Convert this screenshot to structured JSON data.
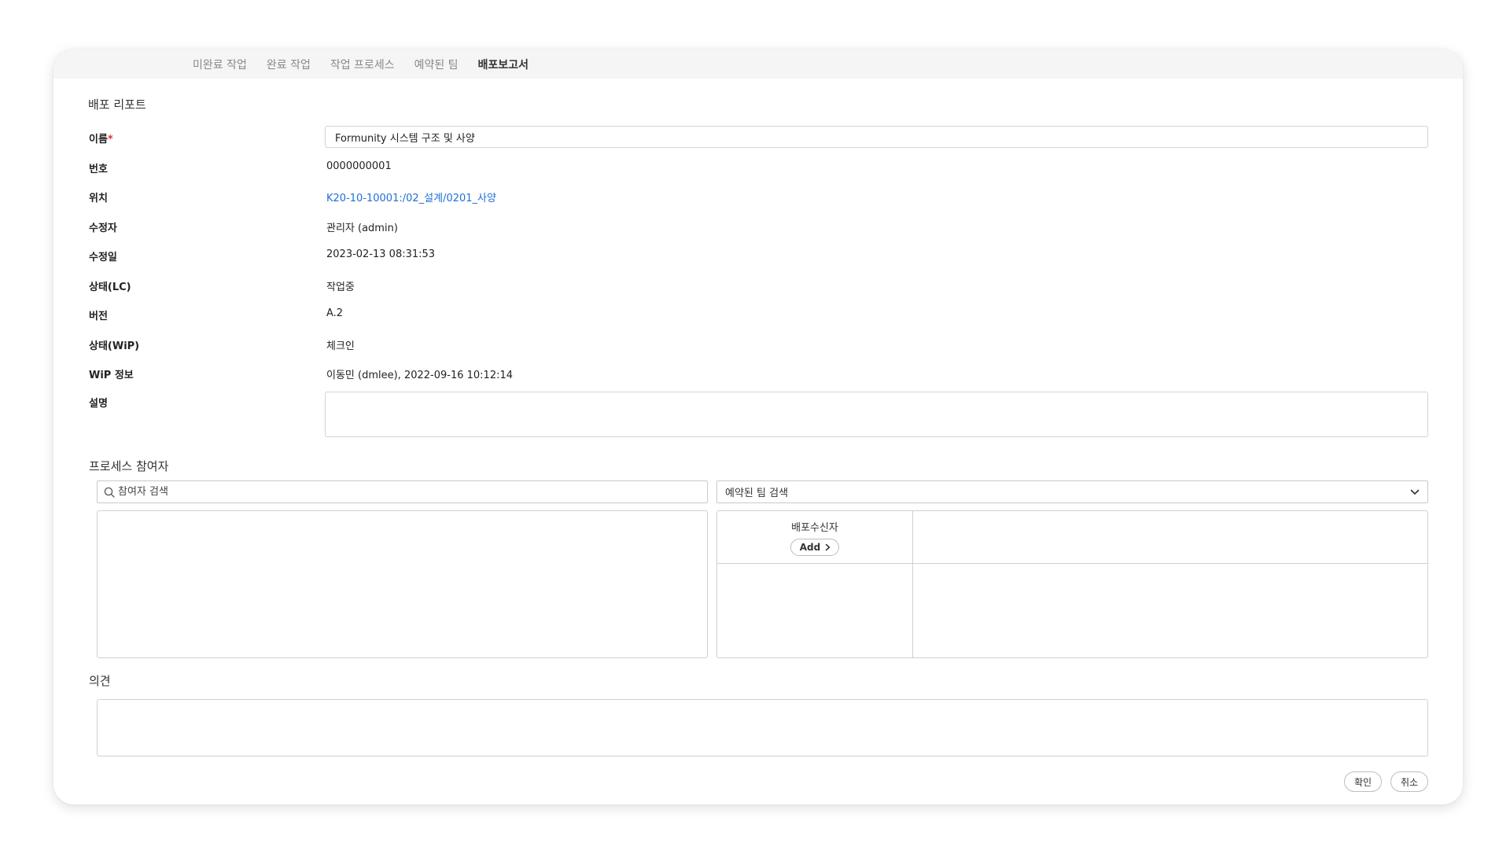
{
  "tabs": [
    {
      "label": "미완료 작업",
      "active": false
    },
    {
      "label": "완료 작업",
      "active": false
    },
    {
      "label": "작업 프로세스",
      "active": false
    },
    {
      "label": "예약된 팀",
      "active": false
    },
    {
      "label": "배포보고서",
      "active": true
    }
  ],
  "report": {
    "title": "배포 리포트",
    "name_label": "이름",
    "required_mark": "*",
    "name_value": "Formunity 시스템 구조 및 사양",
    "number_label": "번호",
    "number_value": "0000000001",
    "location_label": "위치",
    "location_value": "K20-10-10001:/02_설계/0201_사양",
    "modifier_label": "수정자",
    "modifier_value": "관리자 (admin)",
    "modified_label": "수정일",
    "modified_value": "2023-02-13 08:31:53",
    "status_lc_label": "상태(LC)",
    "status_lc_value": "작업중",
    "version_label": "버전",
    "version_value": "A.2",
    "status_wip_label": "상태(WiP)",
    "status_wip_value": "체크인",
    "wip_info_label": "WiP 정보",
    "wip_info_value": "이동민 (dmlee), 2022-09-16 10:12:14",
    "description_label": "설명"
  },
  "participants": {
    "title": "프로세스 참여자",
    "search_placeholder": "참여자 검색",
    "team_select": "예약된 팀 검색",
    "recipient_label": "배포수신자",
    "add_label": "Add"
  },
  "opinion": {
    "title": "의견"
  },
  "footer": {
    "confirm_label": "확인",
    "cancel_label": "취소"
  },
  "colors": {
    "accent_link": "#1d6fd8",
    "required": "#e5322d",
    "tab_bar_bg": "#f5f5f5"
  }
}
